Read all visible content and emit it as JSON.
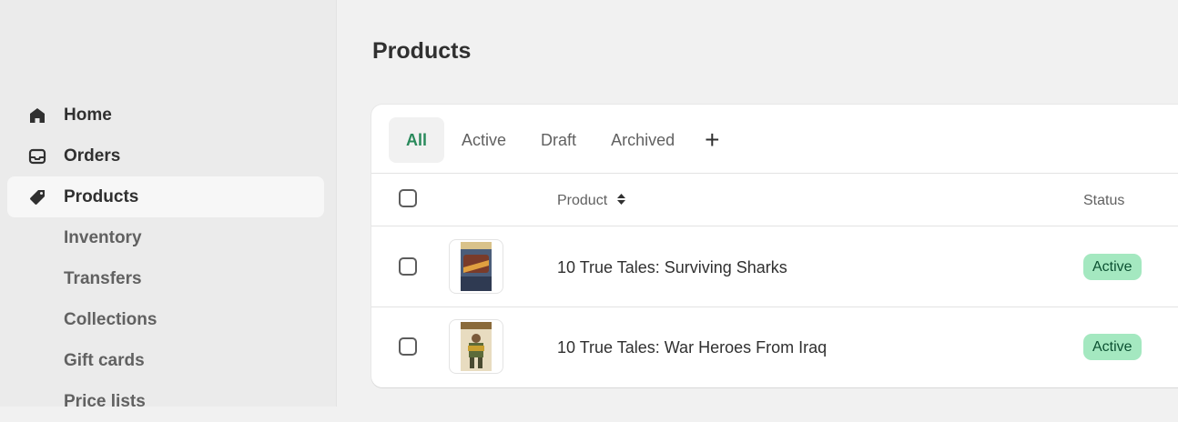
{
  "sidebar": {
    "items": [
      {
        "label": "Home",
        "icon": "home-icon"
      },
      {
        "label": "Orders",
        "icon": "inbox-icon"
      },
      {
        "label": "Products",
        "icon": "tag-icon"
      },
      {
        "label": "Inventory"
      },
      {
        "label": "Transfers"
      },
      {
        "label": "Collections"
      },
      {
        "label": "Gift cards"
      },
      {
        "label": "Price lists"
      }
    ]
  },
  "page": {
    "title": "Products"
  },
  "tabs": [
    {
      "label": "All"
    },
    {
      "label": "Active"
    },
    {
      "label": "Draft"
    },
    {
      "label": "Archived"
    },
    {
      "label": "+"
    }
  ],
  "table": {
    "headers": {
      "product": "Product",
      "status": "Status"
    },
    "rows": [
      {
        "title": "10 True Tales: Surviving Sharks",
        "status": "Active"
      },
      {
        "title": "10 True Tales: War Heroes From Iraq",
        "status": "Active"
      }
    ]
  },
  "colors": {
    "accent": "#2a8a5c",
    "active_badge_bg": "#a4e8c0",
    "active_badge_text": "#0c5132"
  }
}
